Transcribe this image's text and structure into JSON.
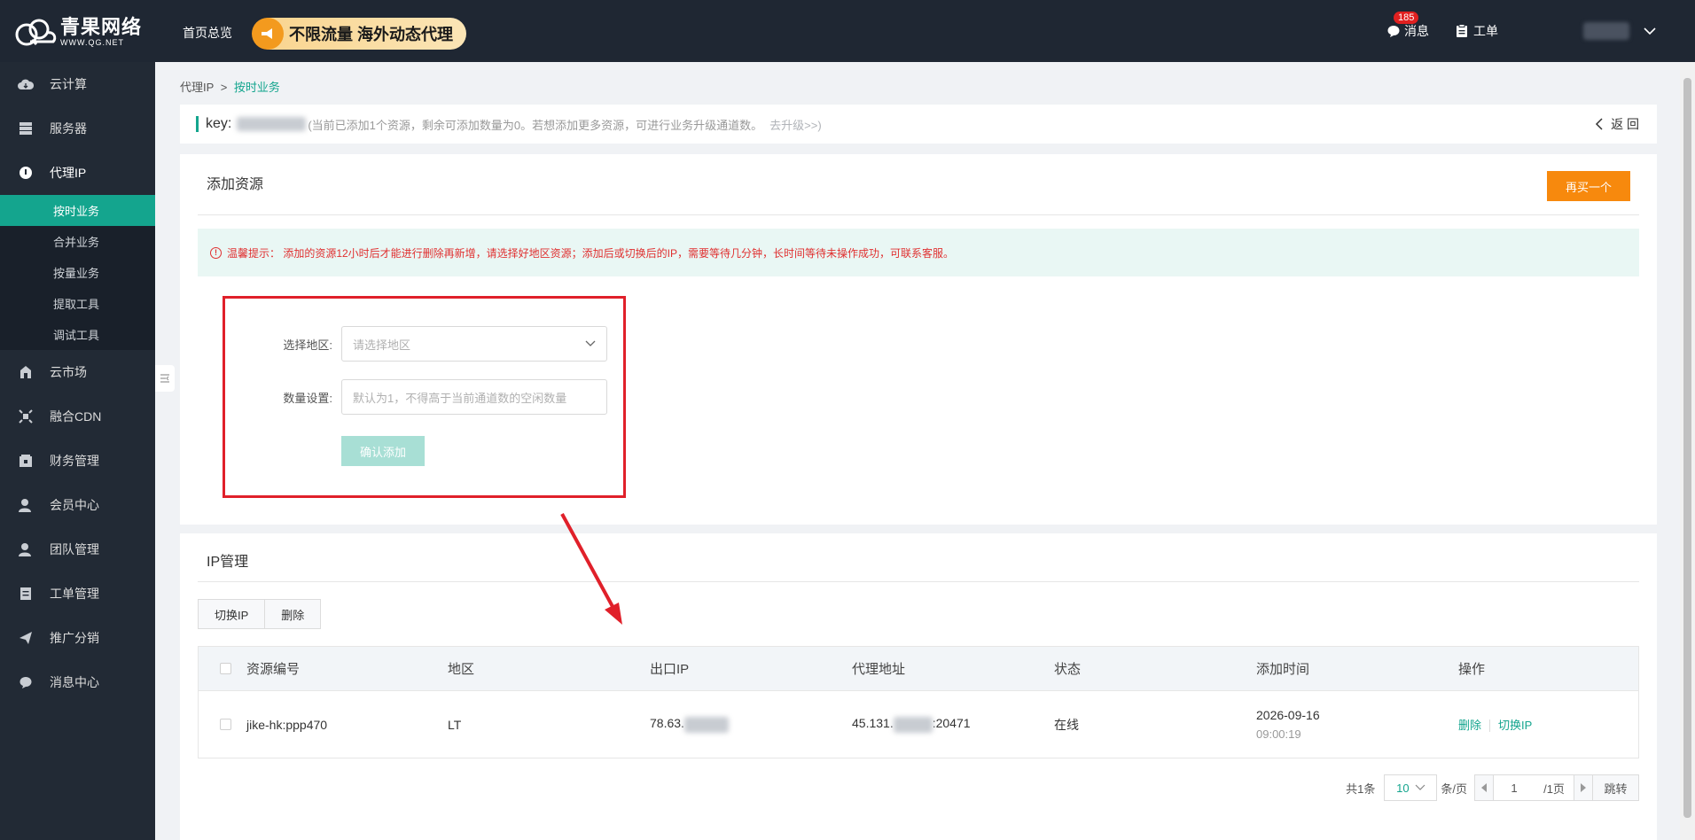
{
  "brand": {
    "name_cn": "青果网络",
    "name_en": "WWW.QG.NET"
  },
  "topnav": {
    "home": "首页总览",
    "promo": "不限流量 海外动态代理",
    "messages_label": "消息",
    "messages_badge": "185",
    "ticket_label": "工单"
  },
  "sidebar": {
    "items": [
      {
        "label": "云计算",
        "icon": "cloud-icon"
      },
      {
        "label": "服务器",
        "icon": "server-icon"
      },
      {
        "label": "代理IP",
        "icon": "proxy-icon"
      },
      {
        "label": "云市场",
        "icon": "market-icon"
      },
      {
        "label": "融合CDN",
        "icon": "cdn-icon"
      },
      {
        "label": "财务管理",
        "icon": "finance-icon"
      },
      {
        "label": "会员中心",
        "icon": "member-icon"
      },
      {
        "label": "团队管理",
        "icon": "team-icon"
      },
      {
        "label": "工单管理",
        "icon": "ticket-icon"
      },
      {
        "label": "推广分销",
        "icon": "send-icon"
      },
      {
        "label": "消息中心",
        "icon": "chat-icon"
      }
    ],
    "sub_items": [
      "按时业务",
      "合并业务",
      "按量业务",
      "提取工具",
      "调试工具"
    ]
  },
  "breadcrumb": {
    "parent": "代理IP",
    "sep": ">",
    "current": "按时业务"
  },
  "keybar": {
    "key_label": "key:",
    "note": "(当前已添加1个资源，剩余可添加数量为0。若想添加更多资源，可进行业务升级通道数。",
    "upgrade": "去升级>>)",
    "back": "返 回"
  },
  "add_card": {
    "title": "添加资源",
    "buy_again": "再买一个",
    "tip": "温馨提示：  添加的资源12小时后才能进行删除再新增，请选择好地区资源；添加后或切换后的IP，需要等待几分钟，长时间等待未操作成功，可联系客服。",
    "region_label": "选择地区:",
    "region_placeholder": "请选择地区",
    "qty_label": "数量设置:",
    "qty_placeholder": "默认为1，不得高于当前通道数的空闲数量",
    "confirm": "确认添加"
  },
  "ip_card": {
    "title": "IP管理",
    "btn_switch": "切换IP",
    "btn_delete": "删除",
    "columns": [
      "资源编号",
      "地区",
      "出口IP",
      "代理地址",
      "状态",
      "添加时间",
      "操作"
    ],
    "rows": [
      {
        "id": "jike-hk:ppp470",
        "region": "LT",
        "exit_ip": "78.63.",
        "proxy_prefix": "45.131.",
        "proxy_suffix": ":20471",
        "status": "在线",
        "date": "2026-09-16",
        "time": "09:00:19",
        "op_delete": "删除",
        "op_switch": "切换IP"
      }
    ]
  },
  "pager": {
    "total": "共1条",
    "page_size": "10",
    "per_page": "条/页",
    "page": "1",
    "pages": "/1页",
    "jump": "跳转"
  },
  "colors": {
    "accent": "#14a58e",
    "orange": "#f7890d",
    "danger": "#e0202a",
    "sidebar": "#222a35"
  }
}
